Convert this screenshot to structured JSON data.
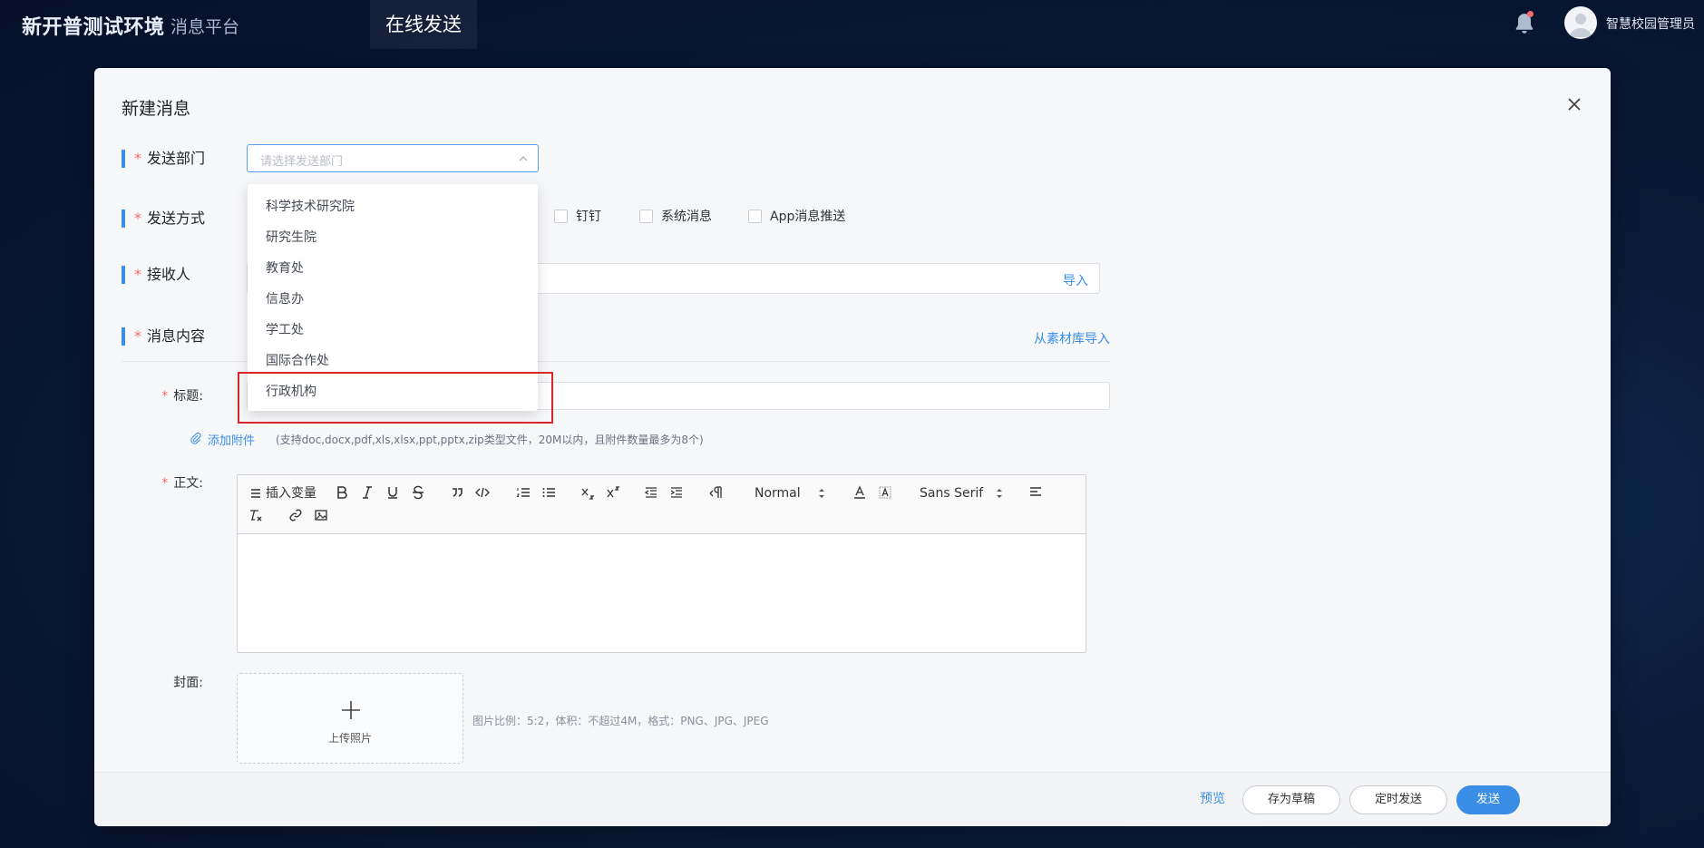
{
  "header": {
    "brand": "新开普测试环境",
    "platform": "消息平台",
    "active_nav": "在线发送",
    "user_name": "智慧校园管理员"
  },
  "modal": {
    "title": "新建消息",
    "sections": {
      "department": {
        "label": "发送部门",
        "placeholder": "请选择发送部门"
      },
      "method": {
        "label": "发送方式",
        "options": [
          "钉钉",
          "系统消息",
          "App消息推送"
        ]
      },
      "receiver": {
        "label": "接收人",
        "import_label": "导入"
      },
      "content": {
        "label": "消息内容",
        "library_import": "从素材库导入"
      }
    },
    "title_field": {
      "label": "标题:"
    },
    "attachment": {
      "label": "添加附件",
      "hint": "(支持doc,docx,pdf,xls,xlsx,ppt,pptx,zip类型文件，20M以内，且附件数量最多为8个)"
    },
    "body_field": {
      "label": "正文:",
      "toolbar": {
        "insert_variable": "插入变量",
        "header_select": "Normal",
        "font_select": "Sans Serif"
      }
    },
    "cover": {
      "label": "封面:",
      "upload_text": "上传照片",
      "hint": "图片比例：5:2，体积：不超过4M，格式：PNG、JPG、JPEG"
    },
    "footer": {
      "preview": "预览",
      "save_draft": "存为草稿",
      "scheduled": "定时发送",
      "send": "发送"
    }
  },
  "dropdown": {
    "items": [
      "科学技术研究院",
      "研究生院",
      "教育处",
      "信息办",
      "学工处",
      "国际合作处",
      "行政机构"
    ]
  },
  "colors": {
    "accent": "#3a8ee6",
    "required": "#f56c6c",
    "highlight": "#d8262a"
  }
}
